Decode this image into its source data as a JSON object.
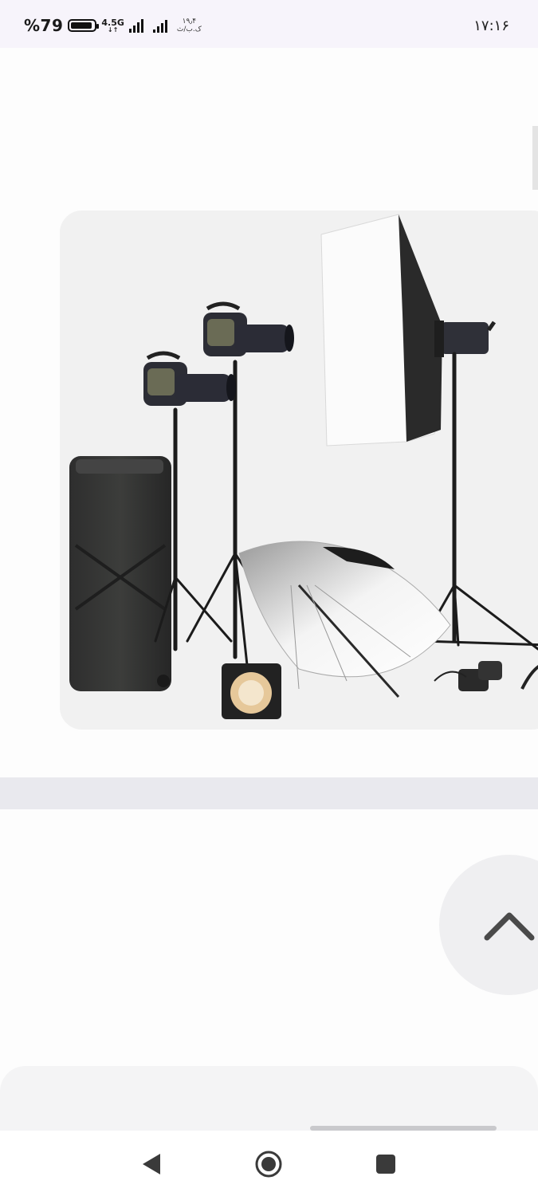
{
  "status_bar": {
    "battery_percent": "%79",
    "network_type": "4.5G",
    "network_sub": "↓↑",
    "speed_value": "۱۹٫۴",
    "speed_unit": "ک.ب/ث",
    "time": "۱۷:۱۶",
    "icons": [
      "battery-icon",
      "signal-icon",
      "signal-icon"
    ]
  },
  "content": {
    "product_image": "studio-lighting-kit-photo",
    "scroll_top_icon": "chevron-up-icon"
  },
  "navigation": {
    "back_icon": "back-triangle-icon",
    "home_icon": "home-circle-icon",
    "recent_icon": "recent-square-icon"
  }
}
